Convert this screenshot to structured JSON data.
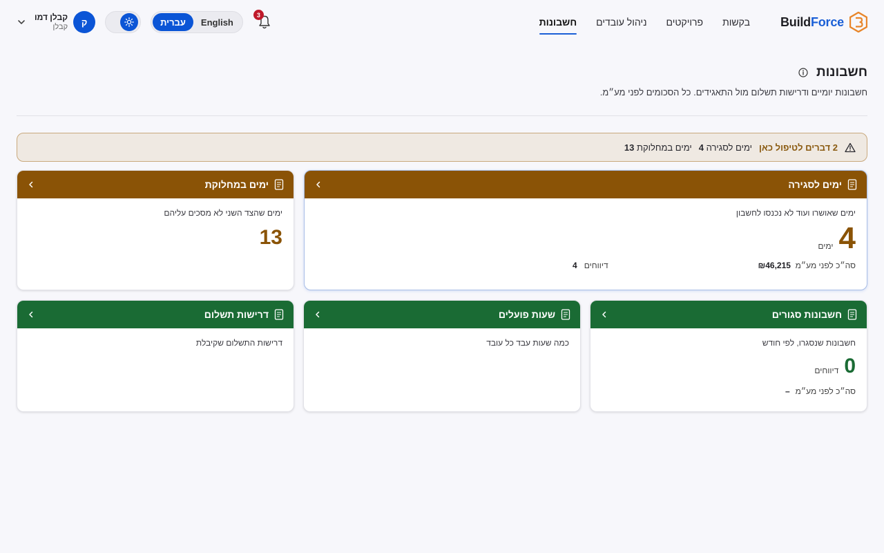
{
  "header": {
    "brand_part1": "Build",
    "brand_part2": "Force",
    "nav": [
      {
        "label": "בקשות",
        "active": false
      },
      {
        "label": "פרויקטים",
        "active": false
      },
      {
        "label": "ניהול עובדים",
        "active": false
      },
      {
        "label": "חשבונות",
        "active": true
      }
    ],
    "notifications_count": "3",
    "lang_english": "English",
    "lang_hebrew": "עברית",
    "user_name": "קבלן דמו",
    "user_role": "קבלן",
    "avatar_letter": "ק"
  },
  "page": {
    "title": "חשבונות",
    "subtitle": "חשבונות יומיים ודרישות תשלום מול התאגידים. כל הסכומים לפני מע״מ."
  },
  "alert": {
    "count": "2",
    "text": "דברים לטיפול כאן",
    "item1_label": "ימים לסגירה",
    "item1_value": "4",
    "item2_label": "ימים במחלוקת",
    "item2_value": "13"
  },
  "cards": {
    "closing": {
      "title": "ימים לסגירה",
      "desc": "ימים שאושרו ועוד לא נכנסו לחשבון",
      "value": "4",
      "unit": "ימים",
      "total_label": "סה״כ לפני מע״מ",
      "total_value": "₪46,215",
      "reports_label": "דיווחים",
      "reports_value": "4"
    },
    "disputed": {
      "title": "ימים במחלוקת",
      "desc": "ימים שהצד השני לא מסכים עליהם",
      "value": "13"
    },
    "closed": {
      "title": "חשבונות סגורים",
      "desc": "חשבונות שנסגרו, לפי חודש",
      "value": "0",
      "unit": "דיווחים",
      "total_label": "סה״כ לפני מע״מ",
      "total_value": "–"
    },
    "hours": {
      "title": "שעות פועלים",
      "desc": "כמה שעות עבד כל עובד"
    },
    "payments": {
      "title": "דרישות תשלום",
      "desc": "דרישות התשלום שקיבלת"
    }
  },
  "colors": {
    "primary": "#0b55d6",
    "brown": "#8a5306",
    "green": "#1a6b34",
    "logo_orange": "#e8862a"
  }
}
